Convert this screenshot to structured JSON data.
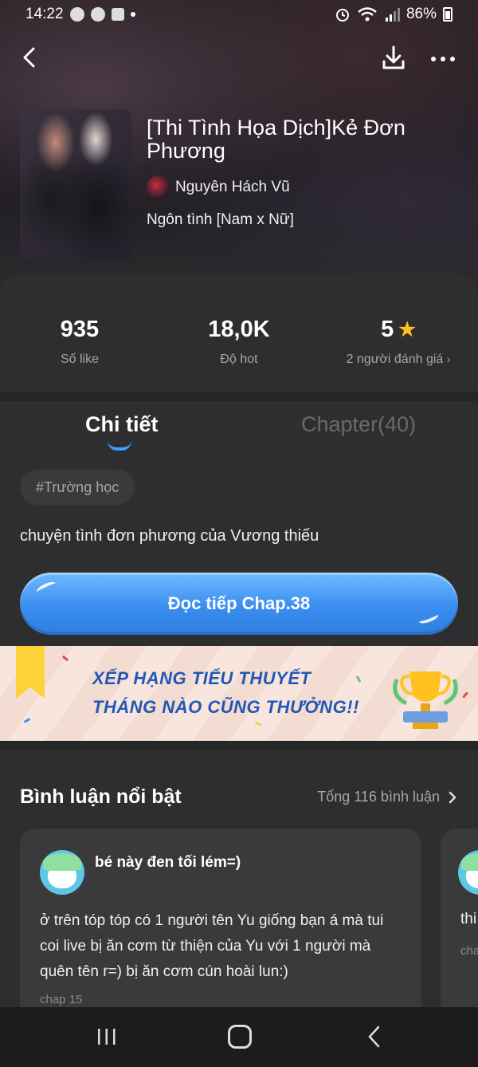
{
  "status_bar": {
    "time": "14:22",
    "battery": "86%"
  },
  "book": {
    "title": "[Thi Tình Họa Dịch]Kẻ Đơn Phương",
    "author": "Nguyên Hách Vũ",
    "genre": "Ngôn tình [Nam x Nữ]"
  },
  "stats": {
    "likes_value": "935",
    "likes_label": "Số like",
    "hot_value": "18,0K",
    "hot_label": "Độ hot",
    "rating_value": "5",
    "rating_label": "2 người đánh giá"
  },
  "tabs": {
    "detail": "Chi tiết",
    "chapter": "Chapter(40)"
  },
  "detail": {
    "tag": "#Trường học",
    "description": "chuyện tình đơn phương của Vương thiếu",
    "read_button": "Đọc tiếp Chap.38"
  },
  "banner": {
    "line1": "XẾP HẠNG TIỂU THUYẾT",
    "line2": "THÁNG NÀO CŨNG THƯỞNG!!"
  },
  "comments": {
    "title": "Bình luận nổi bật",
    "total": "Tổng 116 bình luận",
    "items": [
      {
        "user": "bé này đen tối lém=)",
        "text": "ở trên tóp tóp có 1 người tên Yu giống bạn á mà tui coi live bị ăn cơm từ thiện của Yu với 1 người mà quên tên r=) bị ăn cơm cún hoài lun:)",
        "chapter": "chap 15"
      },
      {
        "text_peek": "thi",
        "chapter_peek": "cha"
      }
    ]
  },
  "colors": {
    "accent": "#3a8ef0",
    "star": "#ffc21f",
    "background": "#2e2e30"
  }
}
